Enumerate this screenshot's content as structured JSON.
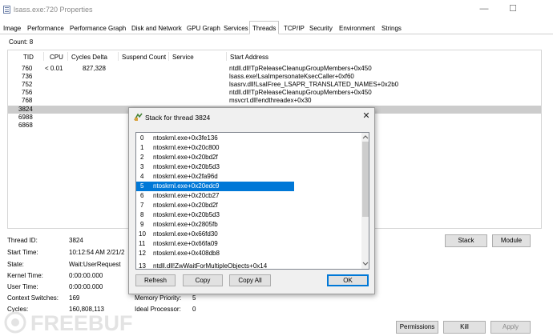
{
  "window": {
    "title": "lsass.exe:720 Properties",
    "minimize_glyph": "—",
    "maximize_glyph": "☐"
  },
  "tabs": [
    "Image",
    "Performance",
    "Performance Graph",
    "Disk and Network",
    "GPU Graph",
    "Services",
    "Threads",
    "TCP/IP",
    "Security",
    "Environment",
    "Strings"
  ],
  "active_tab": "Threads",
  "count": "Count:  8",
  "columns": {
    "tid": "TID",
    "cpu": "CPU",
    "cycles": "Cycles Delta",
    "suspend": "Suspend Count",
    "service": "Service",
    "start": "Start Address"
  },
  "threads": [
    {
      "tid": "760",
      "cpu": "< 0.01",
      "cycles": "827,328",
      "start": "ntdll.dll!TpReleaseCleanupGroupMembers+0x450"
    },
    {
      "tid": "736",
      "cpu": "",
      "cycles": "",
      "start": "lsass.exe!LsaImpersonateKsecCaller+0xf60"
    },
    {
      "tid": "752",
      "cpu": "",
      "cycles": "",
      "start": "lsasrv.dll!LsaIFree_LSAPR_TRANSLATED_NAMES+0x2b0"
    },
    {
      "tid": "756",
      "cpu": "",
      "cycles": "",
      "start": "ntdll.dll!TpReleaseCleanupGroupMembers+0x450"
    },
    {
      "tid": "768",
      "cpu": "",
      "cycles": "",
      "start": "msvcrt.dll!endthreadex+0x30"
    },
    {
      "tid": "3824",
      "cpu": "",
      "cycles": "",
      "start": ""
    },
    {
      "tid": "6988",
      "cpu": "",
      "cycles": "",
      "start": ""
    },
    {
      "tid": "6868",
      "cpu": "",
      "cycles": "",
      "start": ""
    }
  ],
  "selected_thread_index": 5,
  "info": {
    "thread_id_label": "Thread ID:",
    "thread_id": "3824",
    "start_time_label": "Start Time:",
    "start_time": "10:12:54 AM   2/21/2",
    "state_label": "State:",
    "state": "Wait:UserRequest",
    "kernel_time_label": "Kernel Time:",
    "kernel_time": "0:00:00.000",
    "user_time_label": "User Time:",
    "user_time": "0:00:00.000",
    "context_switches_label": "Context Switches:",
    "context_switches": "169",
    "cycles_label": "Cycles:",
    "cycles": "160,808,113",
    "memory_priority_label": "Memory Priority:",
    "memory_priority": "5",
    "ideal_processor_label": "Ideal Processor:",
    "ideal_processor": "0"
  },
  "buttons": {
    "stack": "Stack",
    "module": "Module",
    "permissions": "Permissions",
    "kill": "Kill",
    "apply": "Apply"
  },
  "dialog": {
    "title": "Stack for thread 3824",
    "close_glyph": "✕",
    "frames": [
      {
        "n": "0",
        "addr": "ntoskrnl.exe+0x3fe136"
      },
      {
        "n": "1",
        "addr": "ntoskrnl.exe+0x20c800"
      },
      {
        "n": "2",
        "addr": "ntoskrnl.exe+0x20bd2f"
      },
      {
        "n": "3",
        "addr": "ntoskrnl.exe+0x20b5d3"
      },
      {
        "n": "4",
        "addr": "ntoskrnl.exe+0x2fa96d"
      },
      {
        "n": "5",
        "addr": "ntoskrnl.exe+0x20edc9"
      },
      {
        "n": "6",
        "addr": "ntoskrnl.exe+0x20cb27"
      },
      {
        "n": "7",
        "addr": "ntoskrnl.exe+0x20bd2f"
      },
      {
        "n": "8",
        "addr": "ntoskrnl.exe+0x20b5d3"
      },
      {
        "n": "9",
        "addr": "ntoskrnl.exe+0x2805fb"
      },
      {
        "n": "10",
        "addr": "ntoskrnl.exe+0x66fd30"
      },
      {
        "n": "11",
        "addr": "ntoskrnl.exe+0x66fa09"
      },
      {
        "n": "12",
        "addr": "ntoskrnl.exe+0x408db8"
      },
      {
        "n": "13",
        "addr": "ntdll.dll!ZwWaitForMultipleObjects+0x14"
      }
    ],
    "selected_frame_index": 5,
    "buttons": {
      "refresh": "Refresh",
      "copy": "Copy",
      "copy_all": "Copy All",
      "ok": "OK"
    }
  },
  "watermark": "FREEBUF",
  "colors": {
    "selection_blue": "#0078d7",
    "selected_row_gray": "#cccccc",
    "dialog_bg": "#f0f0f0"
  }
}
